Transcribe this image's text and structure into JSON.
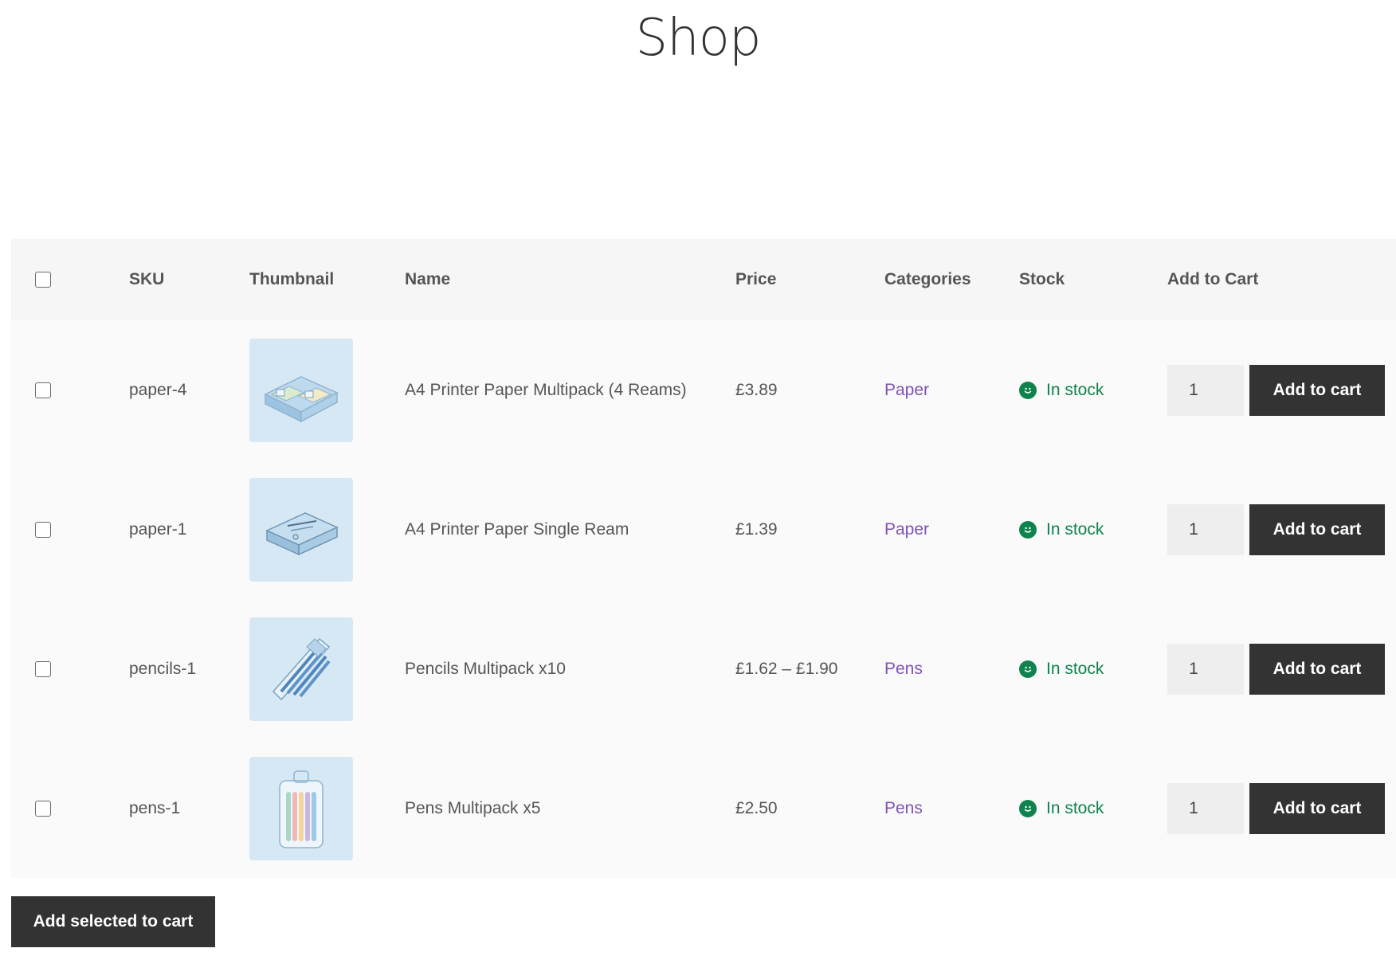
{
  "page": {
    "title": "Shop"
  },
  "table": {
    "headers": {
      "sku": "SKU",
      "thumbnail": "Thumbnail",
      "name": "Name",
      "price": "Price",
      "categories": "Categories",
      "stock": "Stock",
      "add_to_cart": "Add to Cart"
    },
    "rows": [
      {
        "sku": "paper-4",
        "thumb_icon": "paper-multipack-icon",
        "name": "A4 Printer Paper Multipack (4 Reams)",
        "price": "£3.89",
        "category": "Paper",
        "stock": "In stock",
        "qty": "1",
        "button": "Add to cart"
      },
      {
        "sku": "paper-1",
        "thumb_icon": "paper-ream-icon",
        "name": "A4 Printer Paper Single Ream",
        "price": "£1.39",
        "category": "Paper",
        "stock": "In stock",
        "qty": "1",
        "button": "Add to cart"
      },
      {
        "sku": "pencils-1",
        "thumb_icon": "pencils-pack-icon",
        "name": "Pencils Multipack x10",
        "price": "£1.62 – £1.90",
        "category": "Pens",
        "stock": "In stock",
        "qty": "1",
        "button": "Add to cart"
      },
      {
        "sku": "pens-1",
        "thumb_icon": "pens-pack-icon",
        "name": "Pens Multipack x5",
        "price": "£2.50",
        "category": "Pens",
        "stock": "In stock",
        "qty": "1",
        "button": "Add to cart"
      }
    ]
  },
  "bulk_button": "Add selected to cart",
  "colors": {
    "button_bg": "#333333",
    "category_link": "#7f54b3",
    "stock_green": "#0f834d",
    "thumb_bg": "#d6e8f3"
  }
}
